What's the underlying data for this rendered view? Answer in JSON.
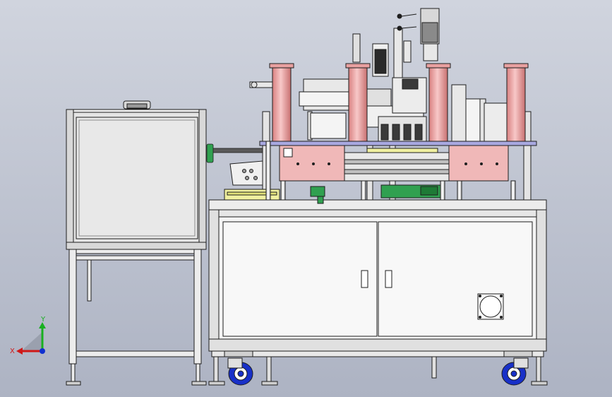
{
  "axis_triad": {
    "y_label": "Y",
    "x_label": "X",
    "colors": {
      "y": "#18b020",
      "x": "#d01818",
      "z": "#1030d0"
    }
  },
  "palette": {
    "background_top": "#d0d4de",
    "background_bottom": "#adb3c3",
    "frame": "#f2f2f2",
    "outline": "#1e1e1e",
    "cylinder": "#e8a0a0",
    "plate": "#f0b8b8",
    "purple_plate": "#a8a8e0",
    "green_part": "#30a050",
    "yellow_tray": "#f0f0a0",
    "caster_wheel": "#1830c8"
  },
  "icons": [
    "cabinet-door-handle-icon",
    "ventilation-fan-icon",
    "caster-wheel-icon",
    "coordinate-axes-icon"
  ]
}
